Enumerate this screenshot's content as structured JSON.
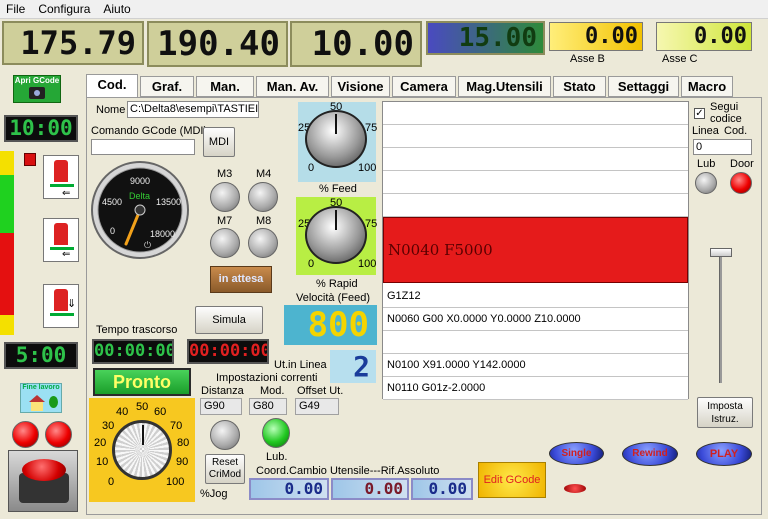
{
  "menu": [
    "File",
    "Configura",
    "Aiuto"
  ],
  "axes": {
    "x": "175.79",
    "y": "190.40",
    "z": "10.00",
    "a": "15.00",
    "b": "0.00",
    "b_label": "Asse B",
    "c": "0.00",
    "c_label": "Asse C"
  },
  "left": {
    "open_gcode": "Apri GCode",
    "clock1": "10:00",
    "clock2": "5:00",
    "end_work": "Fine lavoro"
  },
  "tabs": [
    "Cod.",
    "Graf.",
    "Man.",
    "Man. Av.",
    "Visione",
    "Camera",
    "Mag.Utensili",
    "Stato",
    "Settaggi",
    "Macro"
  ],
  "file": {
    "label": "Nome",
    "value": "C:\\Delta8\\esempi\\TASTIEI"
  },
  "mdi": {
    "label": "Comando GCode (MDI)",
    "value": "",
    "button": "MDI"
  },
  "gauge": {
    "brand": "Delta",
    "ticks": [
      "9000",
      "4500",
      "13500",
      "0",
      "18000"
    ]
  },
  "mcodes": [
    "M3",
    "M4",
    "M7",
    "M8"
  ],
  "status_button": "in attesa",
  "feed": {
    "ticks": [
      "50",
      "25",
      "75",
      "0",
      "100"
    ],
    "label": "% Feed"
  },
  "rapid": {
    "ticks": [
      "50",
      "25",
      "75",
      "0",
      "100"
    ],
    "label": "% Rapid"
  },
  "velocity": {
    "label": "Velocità (Feed)",
    "value": "800"
  },
  "simula": "Simula",
  "tempo": {
    "label": "Tempo trascorso",
    "elapsed": "00:00:00",
    "remaining": "00:00:00"
  },
  "line": {
    "label": "Ut.in Linea",
    "value": "2"
  },
  "pronto": "Pronto",
  "settings": {
    "title": "Impostazioni correnti",
    "distanza_label": "Distanza",
    "distanza": "G90",
    "mod_label": "Mod.",
    "mod": "G80",
    "offset_label": "Offset Ut.",
    "offset": "G49"
  },
  "jog": {
    "ticks": [
      "50",
      "40",
      "60",
      "30",
      "70",
      "20",
      "80",
      "10",
      "90",
      "0",
      "100"
    ],
    "label": "%Jog"
  },
  "reset": "Reset\nCriMod",
  "lub": "Lub.",
  "coords": {
    "title": "Coord.Cambio Utensile---Rif.Assoluto",
    "v1": "0.00",
    "v2": "0.00",
    "v3": "0.00"
  },
  "edit_gcode": "Edit GCode",
  "code_lines": {
    "current": "N0040  F5000",
    "l1": "G1Z12",
    "l2": "N0060 G00 X0.0000 Y0.0000 Z10.0000",
    "l3": "",
    "l4": "N0100 X91.0000 Y142.0000",
    "l5": "N0110 G01z-2.0000"
  },
  "right": {
    "segui_label": "Segui codice",
    "linea_label": "Linea",
    "cod_label": "Cod.",
    "linea_value": "0",
    "lub": "Lub",
    "door": "Door",
    "imposta": "Imposta Istruz."
  },
  "controls": {
    "single": "Single",
    "rewind": "Rewind",
    "play": "PLAY"
  },
  "colors": {
    "active_line": "#e51b1b",
    "lcd_green": "#2ec24a",
    "yellow_lcd": "#f4d400",
    "blue_lcd": "#1c2c8a",
    "pronto_green": "#27b837"
  }
}
